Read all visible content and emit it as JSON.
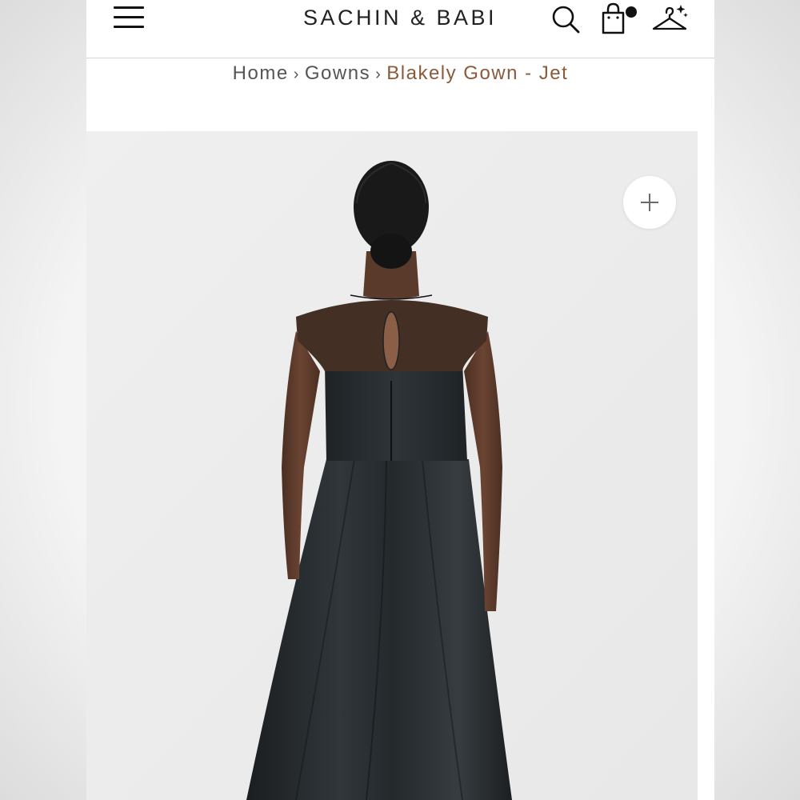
{
  "header": {
    "logo": "SACHIN & BABI",
    "icons": {
      "menu": "hamburger-menu-icon",
      "search": "search-icon",
      "cart": "shopping-bag-icon",
      "wishlist": "hanger-icon"
    }
  },
  "breadcrumb": {
    "items": [
      "Home",
      "Gowns"
    ],
    "separator": "›",
    "current": "Blakely Gown - Jet"
  },
  "product_image": {
    "zoom_icon": "plus-icon"
  },
  "colors": {
    "accent": "#8a5a3a",
    "text": "#222222",
    "cart_badge": "#111111"
  }
}
